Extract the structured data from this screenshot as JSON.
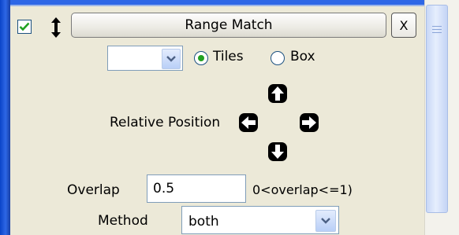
{
  "panel": {
    "title": "Range Match",
    "close_label": "X",
    "enabled": true
  },
  "mode": {
    "select_value": "",
    "options": [
      {
        "label": "Tiles",
        "selected": true
      },
      {
        "label": "Box",
        "selected": false
      }
    ]
  },
  "position": {
    "label": "Relative Position"
  },
  "overlap": {
    "label": "Overlap",
    "value": "0.5",
    "hint": "0<overlap<=1)"
  },
  "method": {
    "label": "Method",
    "value": "both"
  },
  "icons": {
    "check": "checkmark-icon",
    "drag": "drag-handle-icon",
    "dropdown": "chevron-down-icon",
    "arrows": [
      "arrow-up-icon",
      "arrow-left-icon",
      "arrow-right-icon",
      "arrow-down-icon"
    ]
  },
  "colors": {
    "window_frame": "#2e67e6",
    "panel_bg": "#ece9d8",
    "check_green": "#21a121",
    "input_border": "#7f9db9"
  }
}
